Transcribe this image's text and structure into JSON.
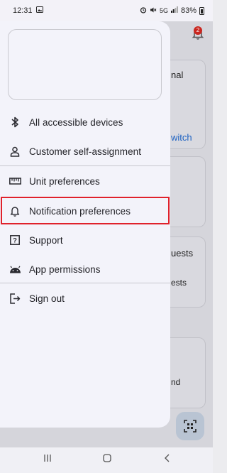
{
  "status_bar": {
    "time": "12:31",
    "signal_label": "5G",
    "battery": "83%"
  },
  "background": {
    "notification_badge": "2",
    "card1": {
      "line1": "nal",
      "link": "witch"
    },
    "card3": {
      "line1": "uests",
      "line2": "ests"
    },
    "card4": {
      "line1": "nd"
    }
  },
  "drawer": {
    "menu": [
      {
        "label": "All accessible devices",
        "icon": "bluetooth-icon"
      },
      {
        "label": "Customer self-assignment",
        "icon": "person-icon"
      },
      {
        "label": "Unit preferences",
        "icon": "ruler-icon"
      },
      {
        "label": "Notification preferences",
        "icon": "bell-icon",
        "highlighted": true
      },
      {
        "label": "Support",
        "icon": "help-icon"
      },
      {
        "label": "App permissions",
        "icon": "android-icon"
      },
      {
        "label": "Sign out",
        "icon": "sign-out-icon"
      }
    ]
  },
  "colors": {
    "highlight": "#e0212b",
    "drawer_bg": "#f3f3fa",
    "link": "#1e62c2"
  }
}
